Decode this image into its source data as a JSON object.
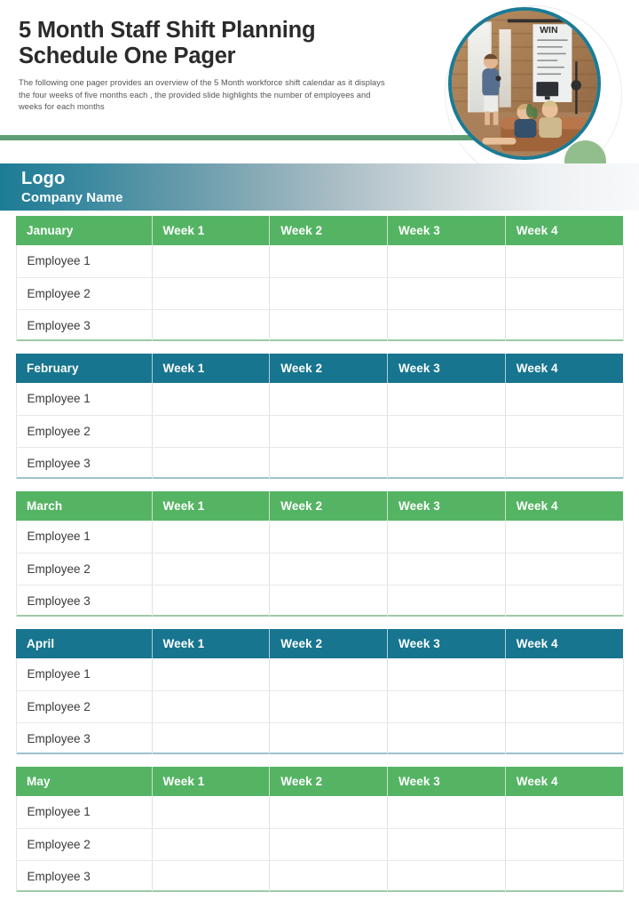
{
  "header": {
    "title": "5 Month Staff Shift Planning Schedule One Pager",
    "subtitle": "The following one pager provides an overview of the 5 Month workforce shift calendar as it displays the four weeks of five  months each , the provided slide highlights the number of employees and weeks for each months",
    "photo_alt": "office-presentation-photo"
  },
  "logo_bar": {
    "logo_label": "Logo",
    "company_name": "Company Name"
  },
  "colors": {
    "green": "#55b464",
    "teal": "#17758f",
    "divider_green": "#5d9e72",
    "accent_circle_green": "#92be8e",
    "photo_border": "#1b7b95",
    "title_text": "#2b2b2b",
    "body_text": "#555555"
  },
  "tables": [
    {
      "month": "January",
      "accent": "green",
      "columns": [
        "January",
        "Week 1",
        "Week 2",
        "Week 3",
        "Week 4"
      ],
      "rows": [
        [
          "Employee 1",
          "",
          "",
          "",
          ""
        ],
        [
          "Employee 2",
          "",
          "",
          "",
          ""
        ],
        [
          "Employee 3",
          "",
          "",
          "",
          ""
        ]
      ]
    },
    {
      "month": "February",
      "accent": "teal",
      "columns": [
        "February",
        "Week 1",
        "Week 2",
        "Week 3",
        "Week 4"
      ],
      "rows": [
        [
          "Employee 1",
          "",
          "",
          "",
          ""
        ],
        [
          "Employee 2",
          "",
          "",
          "",
          ""
        ],
        [
          "Employee 3",
          "",
          "",
          "",
          ""
        ]
      ]
    },
    {
      "month": "March",
      "accent": "green",
      "columns": [
        "March",
        "Week 1",
        "Week 2",
        "Week 3",
        "Week 4"
      ],
      "rows": [
        [
          "Employee 1",
          "",
          "",
          "",
          ""
        ],
        [
          "Employee 2",
          "",
          "",
          "",
          ""
        ],
        [
          "Employee 3",
          "",
          "",
          "",
          ""
        ]
      ]
    },
    {
      "month": "April",
      "accent": "teal",
      "columns": [
        "April",
        "Week 1",
        "Week 2",
        "Week 3",
        "Week 4"
      ],
      "rows": [
        [
          "Employee 1",
          "",
          "",
          "",
          ""
        ],
        [
          "Employee 2",
          "",
          "",
          "",
          ""
        ],
        [
          "Employee 3",
          "",
          "",
          "",
          ""
        ]
      ]
    },
    {
      "month": "May",
      "accent": "green",
      "columns": [
        "May",
        "Week 1",
        "Week 2",
        "Week 3",
        "Week 4"
      ],
      "rows": [
        [
          "Employee 1",
          "",
          "",
          "",
          ""
        ],
        [
          "Employee 2",
          "",
          "",
          "",
          ""
        ],
        [
          "Employee 3",
          "",
          "",
          "",
          ""
        ]
      ]
    }
  ]
}
